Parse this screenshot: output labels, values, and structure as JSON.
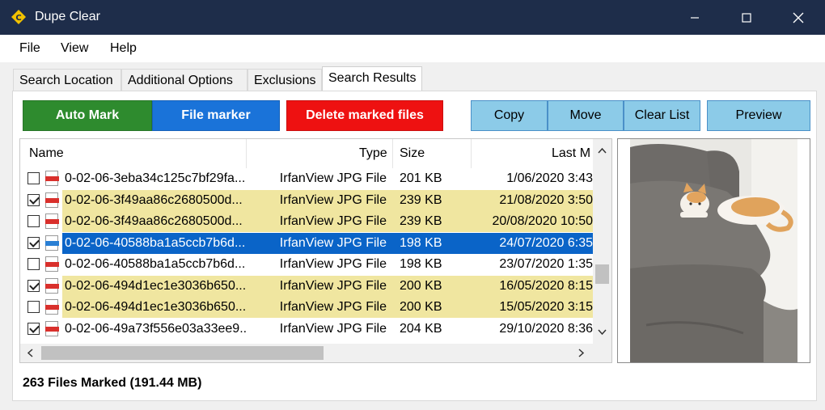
{
  "window": {
    "title": "Dupe Clear"
  },
  "menu": {
    "items": [
      "File",
      "View",
      "Help"
    ]
  },
  "tabs": [
    "Search Location",
    "Additional Options",
    "Exclusions",
    "Search Results"
  ],
  "toolbar": {
    "auto_mark": "Auto Mark",
    "file_marker": "File marker",
    "delete_marked": "Delete marked files",
    "copy": "Copy",
    "move": "Move",
    "clear_list": "Clear List",
    "preview": "Preview"
  },
  "colors": {
    "auto_mark": "#2e8b2e",
    "file_marker": "#1a73d9",
    "delete": "#ee1111",
    "highlight": "#f0e6a0",
    "selected": "#0a64c8"
  },
  "columns": {
    "name": "Name",
    "type": "Type",
    "size": "Size",
    "last": "Last M"
  },
  "rows": [
    {
      "name": "0-02-06-3eba34c125c7bf29fa...",
      "type": "IrfanView JPG File",
      "size": "201 KB",
      "date": "1/06/2020 3:43",
      "checked": false,
      "highlight": false,
      "selected": false
    },
    {
      "name": "0-02-06-3f49aa86c2680500d...",
      "type": "IrfanView JPG File",
      "size": "239 KB",
      "date": "21/08/2020 3:50",
      "checked": true,
      "highlight": true,
      "selected": false
    },
    {
      "name": "0-02-06-3f49aa86c2680500d...",
      "type": "IrfanView JPG File",
      "size": "239 KB",
      "date": "20/08/2020 10:50",
      "checked": false,
      "highlight": true,
      "selected": false
    },
    {
      "name": "0-02-06-40588ba1a5ccb7b6d...",
      "type": "IrfanView JPG File",
      "size": "198 KB",
      "date": "24/07/2020 6:35",
      "checked": true,
      "highlight": false,
      "selected": true
    },
    {
      "name": "0-02-06-40588ba1a5ccb7b6d...",
      "type": "IrfanView JPG File",
      "size": "198 KB",
      "date": "23/07/2020 1:35",
      "checked": false,
      "highlight": false,
      "selected": false
    },
    {
      "name": "0-02-06-494d1ec1e3036b650...",
      "type": "IrfanView JPG File",
      "size": "200 KB",
      "date": "16/05/2020 8:15",
      "checked": true,
      "highlight": true,
      "selected": false
    },
    {
      "name": "0-02-06-494d1ec1e3036b650...",
      "type": "IrfanView JPG File",
      "size": "200 KB",
      "date": "15/05/2020 3:15",
      "checked": false,
      "highlight": true,
      "selected": false
    },
    {
      "name": "0-02-06-49a73f556e03a33ee9...",
      "type": "IrfanView JPG File",
      "size": "204 KB",
      "date": "29/10/2020 8:36",
      "checked": true,
      "highlight": false,
      "selected": false
    }
  ],
  "status": "263 Files Marked (191.44 MB)"
}
